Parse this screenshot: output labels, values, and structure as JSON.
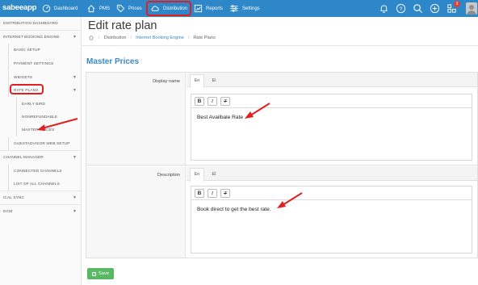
{
  "app": {
    "logo": "sabeeapp"
  },
  "topnav": {
    "items": [
      {
        "label": "Dashboard",
        "icon": "gauge-icon"
      },
      {
        "label": "PMS",
        "icon": "home-icon"
      },
      {
        "label": "Prices",
        "icon": "tag-icon"
      },
      {
        "label": "Distribution",
        "icon": "cloud-sync-icon",
        "highlighted": true
      },
      {
        "label": "Reports",
        "icon": "bar-chart-icon"
      },
      {
        "label": "Settings",
        "icon": "sliders-icon"
      }
    ],
    "right_icons": [
      "bell-icon",
      "help-icon",
      "search-icon",
      "plus-circle-icon",
      "layers-icon",
      "avatar"
    ],
    "badge_count": "3"
  },
  "sidebar": {
    "items": [
      {
        "label": "DISTRIBUTION DASHBOARD",
        "level": 0
      },
      {
        "label": "INTERNET BOOKING ENGINE",
        "level": 0,
        "expanded": true
      },
      {
        "label": "BASIC SETUP",
        "level": 1
      },
      {
        "label": "PAYMENT SETTINGS",
        "level": 1
      },
      {
        "label": "WIDGETS",
        "level": 1,
        "expandable": true
      },
      {
        "label": "RATE PLANS",
        "level": 1,
        "expanded": true,
        "highlighted": true
      },
      {
        "label": "EARLY BIRD",
        "level": 2
      },
      {
        "label": "NONREFUNDABLE",
        "level": 2
      },
      {
        "label": "MASTER PRICES",
        "level": 2,
        "active": true
      },
      {
        "label": "GUESTADVISOR WEB SETUP",
        "level": 1
      },
      {
        "label": "CHANNEL MANAGER",
        "level": 0,
        "expanded": true
      },
      {
        "label": "CONNECTED CHANNELS",
        "level": 1
      },
      {
        "label": "LIST OF ALL CHANNELS",
        "level": 1
      },
      {
        "label": "ICAL SYNC",
        "level": 0,
        "expandable": true
      },
      {
        "label": "DCM",
        "level": 0,
        "expandable": true
      }
    ]
  },
  "page": {
    "title": "Edit rate plan",
    "breadcrumb": [
      "Distribution",
      "Internet Booking Engine",
      "Rate Plans"
    ],
    "section_title": "Master Prices"
  },
  "form": {
    "display_name": {
      "label": "Display name",
      "tabs": [
        "En",
        "El"
      ],
      "active_tab": "En",
      "value": "Best Availbale Rate"
    },
    "description": {
      "label": "Description",
      "tabs": [
        "En",
        "El"
      ],
      "active_tab": "En",
      "value": "Book direct to get the best rate."
    },
    "toolbar": {
      "bold": "B",
      "italic": "I",
      "clear": "T"
    }
  },
  "actions": {
    "save_label": "Save"
  },
  "colors": {
    "topbar": "#2e87c8",
    "accent": "#3a8ac4",
    "highlight": "#e02020",
    "save": "#58b962"
  }
}
